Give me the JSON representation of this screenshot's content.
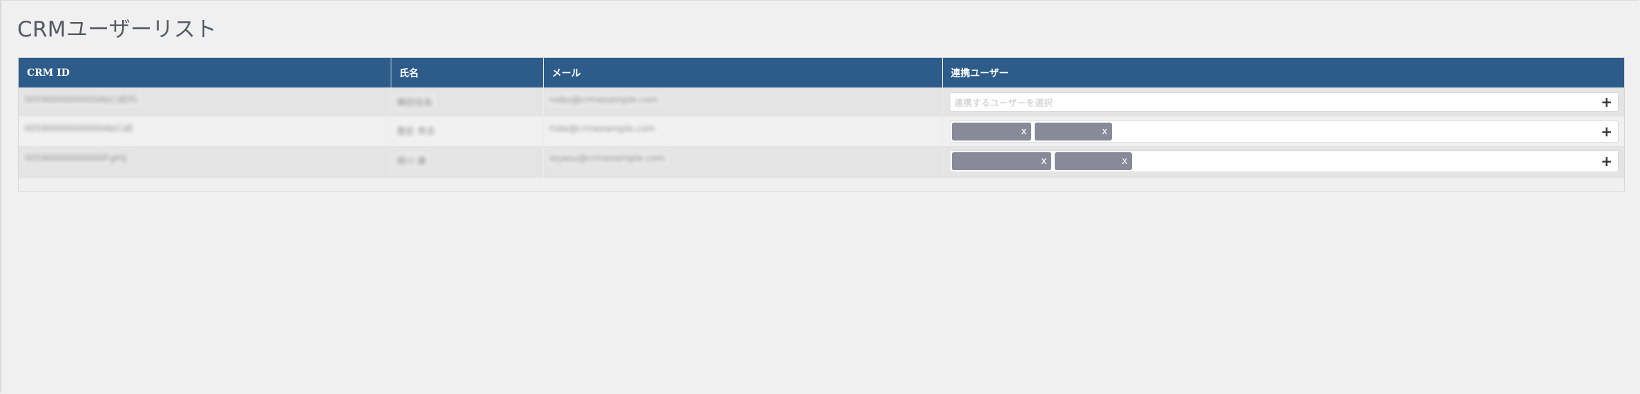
{
  "page": {
    "title": "CRMユーザーリスト"
  },
  "table": {
    "headers": [
      "CRM ID",
      "氏名",
      "メール",
      "連携ユーザー"
    ],
    "rows": [
      {
        "crm_id": "0059000000000AbCdEfG",
        "name": "織田信長",
        "email": "nobu@crmexample.com",
        "linked_placeholder": "連携するユーザーを選択",
        "tags": []
      },
      {
        "crm_id": "00590000000000AbCdE",
        "name": "豊臣 秀吉",
        "email": "hide@crmexample.com",
        "linked_placeholder": "",
        "tags": [
          {
            "remove": "x"
          },
          {
            "remove": "x"
          }
        ]
      },
      {
        "crm_id": "00590000000000FgHiJ",
        "name": "徳川 康",
        "email": "ieyasu@crmexample.com",
        "linked_placeholder": "",
        "tags": [
          {
            "remove": "x"
          },
          {
            "remove": "x"
          }
        ]
      }
    ],
    "add_symbol": "+"
  },
  "colors": {
    "header_bg": "#2d5b8a",
    "tag_bg": "#888a99",
    "page_bg": "#f0f0f0"
  }
}
